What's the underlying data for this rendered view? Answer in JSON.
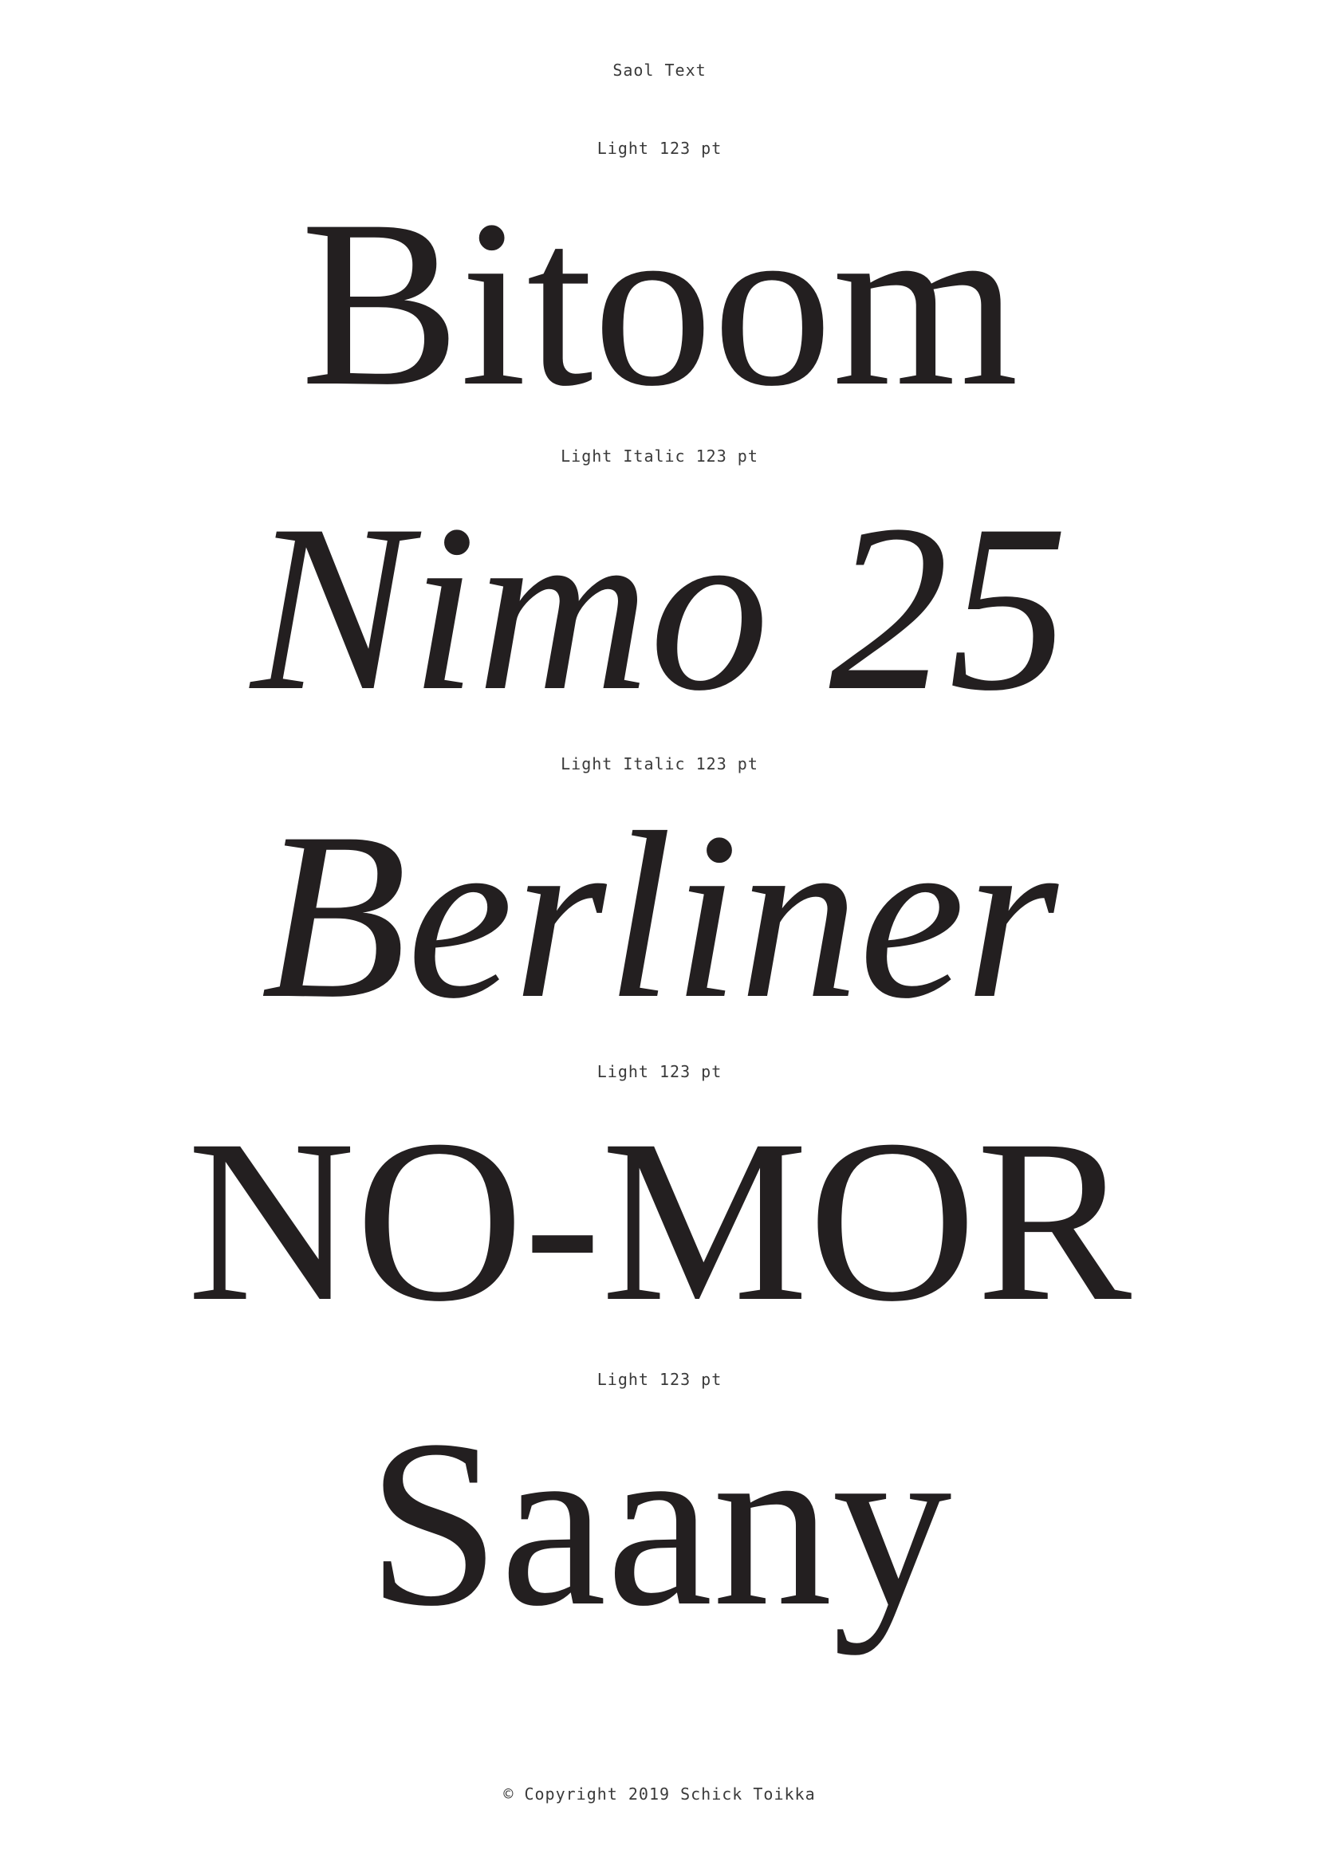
{
  "header": {
    "title": "Saol Text"
  },
  "specimens": [
    {
      "style_label": "Light 123 pt",
      "sample": "Bitoom",
      "style": "roman"
    },
    {
      "style_label": "Light Italic 123 pt",
      "sample": "Nimo 25",
      "style": "italic"
    },
    {
      "style_label": "Light Italic 123 pt",
      "sample": "Berliner",
      "style": "italic"
    },
    {
      "style_label": "Light 123 pt",
      "sample": "NO-MOR",
      "style": "roman"
    },
    {
      "style_label": "Light 123 pt",
      "sample": "Saany",
      "style": "roman"
    }
  ],
  "footer": {
    "copyright": "© Copyright 2019 Schick Toikka"
  },
  "colors": {
    "ink": "#231f20",
    "label": "#3a3a3a",
    "background": "#ffffff"
  }
}
